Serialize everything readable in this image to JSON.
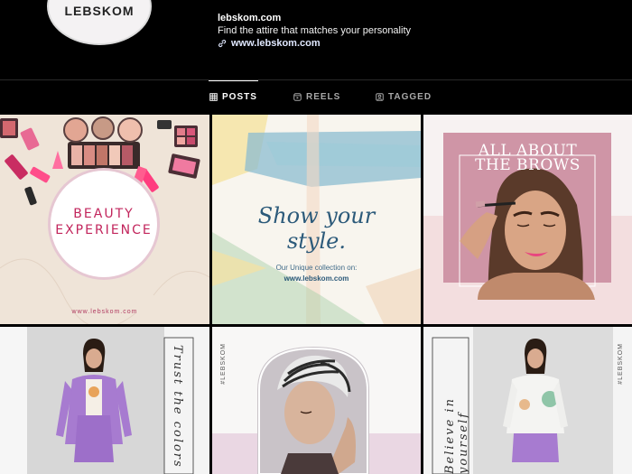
{
  "profile": {
    "avatar_logo": "LEBSKOM",
    "name": "lebskom.com",
    "bio": "Find the attire that matches your personality",
    "website": "www.lebskom.com"
  },
  "tabs": [
    {
      "label": "POSTS",
      "icon": "grid-icon",
      "active": true
    },
    {
      "label": "REELS",
      "icon": "reels-icon",
      "active": false
    },
    {
      "label": "TAGGED",
      "icon": "tagged-icon",
      "active": false
    }
  ],
  "posts": {
    "beauty": {
      "line1": "BEAUTY",
      "line2": "EXPERIENCE",
      "url": "www.lebskom.com"
    },
    "style": {
      "line1": "Show your",
      "line2": "style.",
      "subtitle": "Our Unique collection on:",
      "url": "www.lebskom.com"
    },
    "brows": {
      "line1": "ALL ABOUT",
      "line2": "THE BROWS"
    },
    "trust": {
      "script": "Trust the colors"
    },
    "turban": {
      "brand": "#LEBSKOM"
    },
    "believe": {
      "script": "Believe in yourself",
      "brand": "#LEBSKOM"
    }
  },
  "colors": {
    "background": "#000000",
    "accent_pink": "#c2255c",
    "accent_blue": "#2c5a7a",
    "lavender": "#a77bd0"
  }
}
